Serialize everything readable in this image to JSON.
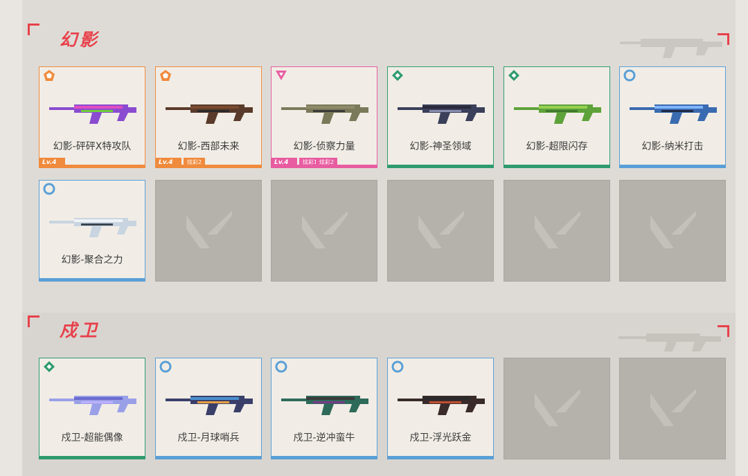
{
  "sections": [
    {
      "title": "幻影",
      "skins": [
        {
          "name": "幻影-砰砰X特攻队",
          "tier": "exclusive",
          "tier_color": "#f08a3c",
          "level": "Lv.4",
          "extras": []
        },
        {
          "name": "幻影-西部未来",
          "tier": "exclusive",
          "tier_color": "#f08a3c",
          "level": "Lv.4",
          "extras": [
            "炫彩2"
          ]
        },
        {
          "name": "幻影-侦察力量",
          "tier": "ultra",
          "tier_color": "#e85ca0",
          "level": "Lv.4",
          "extras": [
            "炫彩1",
            "炫彩2"
          ]
        },
        {
          "name": "幻影-神圣领域",
          "tier": "premium",
          "tier_color": "#2e9b6e",
          "level": "",
          "extras": []
        },
        {
          "name": "幻影-超限闪存",
          "tier": "premium",
          "tier_color": "#2e9b6e",
          "level": "",
          "extras": []
        },
        {
          "name": "幻影-纳米打击",
          "tier": "deluxe",
          "tier_color": "#5a9fd6",
          "level": "",
          "extras": []
        },
        {
          "name": "幻影-聚合之力",
          "tier": "deluxe",
          "tier_color": "#5a9fd6",
          "level": "",
          "extras": []
        }
      ],
      "empty_slots": 5
    },
    {
      "title": "戍卫",
      "skins": [
        {
          "name": "戍卫-超能偶像",
          "tier": "premium",
          "tier_color": "#2e9b6e",
          "level": "",
          "extras": []
        },
        {
          "name": "戍卫-月球哨兵",
          "tier": "deluxe",
          "tier_color": "#5a9fd6",
          "level": "",
          "extras": []
        },
        {
          "name": "戍卫-逆冲蛮牛",
          "tier": "deluxe",
          "tier_color": "#5a9fd6",
          "level": "",
          "extras": []
        },
        {
          "name": "戍卫-浮光跃金",
          "tier": "deluxe",
          "tier_color": "#5a9fd6",
          "level": "",
          "extras": []
        }
      ],
      "empty_slots": 2
    }
  ],
  "icons": {
    "exclusive": "pentagon-icon",
    "ultra": "triangle-icon",
    "premium": "diamond-icon",
    "deluxe": "circle-icon",
    "empty": "valorant-logo-icon"
  },
  "accent_color": "#e8404a"
}
